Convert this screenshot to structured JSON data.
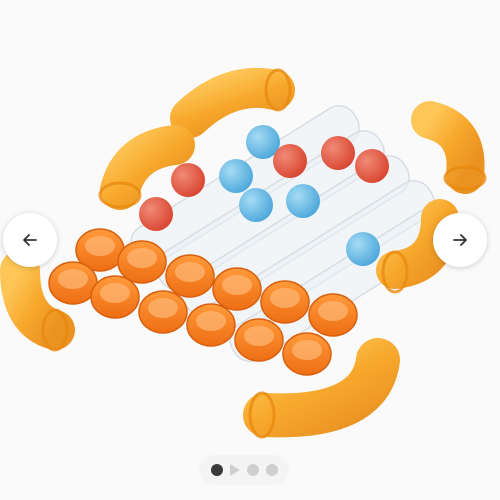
{
  "gallery": {
    "prev_icon": "arrow-left-icon",
    "next_icon": "arrow-right-icon",
    "indicators": [
      {
        "kind": "dot",
        "active": true
      },
      {
        "kind": "play-icon",
        "active": false
      },
      {
        "kind": "dot",
        "active": false
      },
      {
        "kind": "dot",
        "active": false
      }
    ]
  },
  "colors": {
    "tube_orange": "#F7A21B",
    "cap_orange": "#F47C20",
    "ball_red": "#E2553F",
    "ball_blue": "#63B9E6",
    "indicator_active": "#3A3A3A",
    "indicator_inactive": "#CFCFCF"
  }
}
